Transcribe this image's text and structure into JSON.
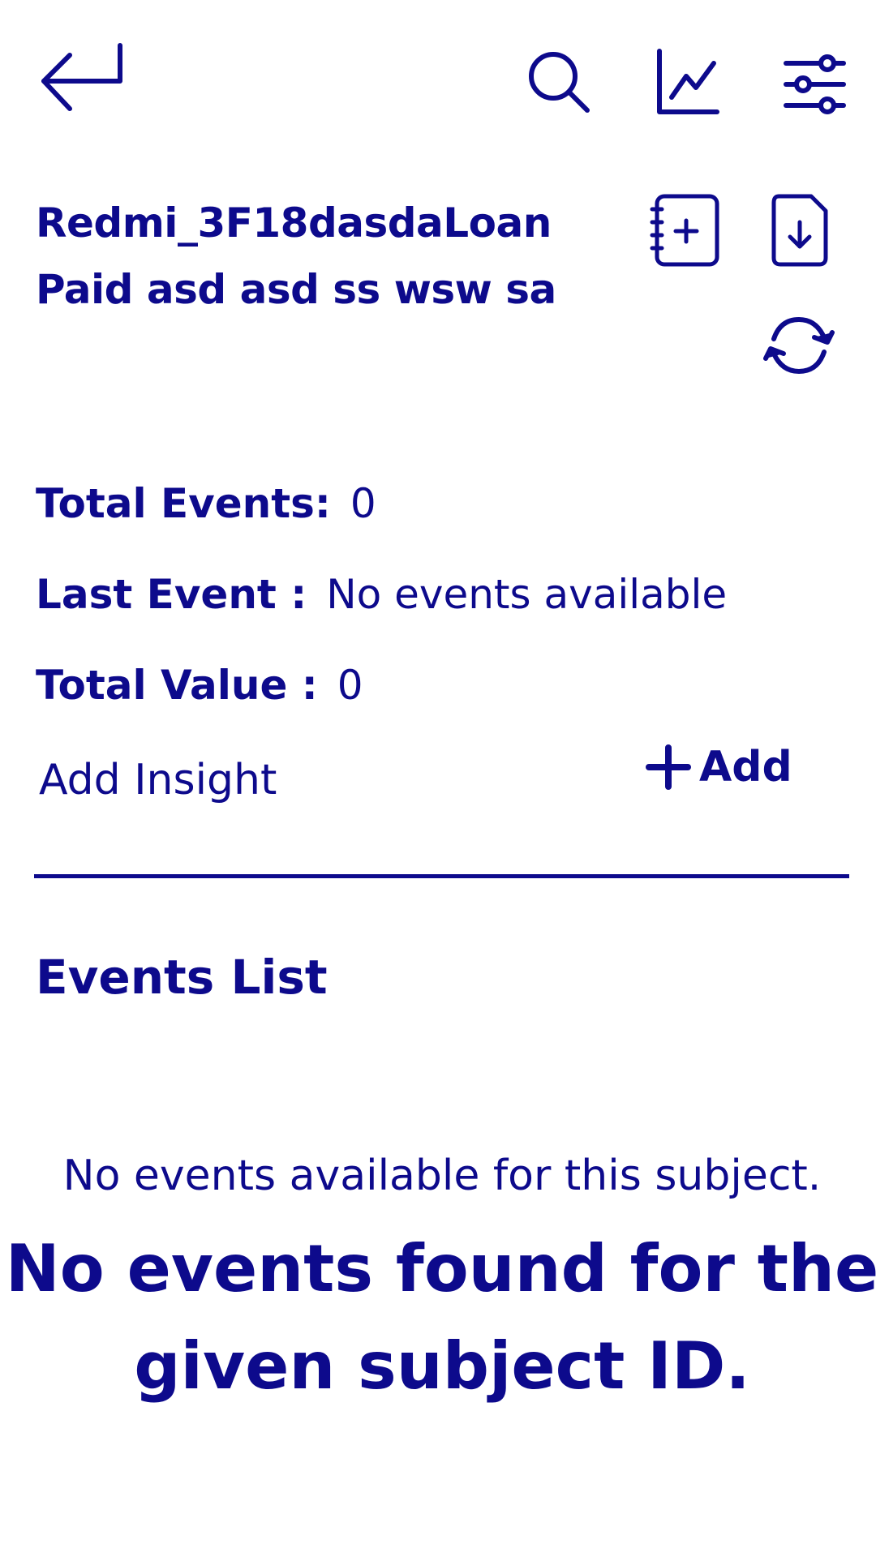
{
  "header": {
    "title": "Redmi_3F18dasdaLoan Paid asd asd ss wsw sa",
    "icons": [
      "back-icon",
      "search-icon",
      "chart-icon",
      "filter-sliders-icon",
      "add-note-icon",
      "download-file-icon",
      "refresh-icon"
    ]
  },
  "stats": {
    "total_events_label": "Total Events:",
    "total_events_value": "0",
    "last_event_label": "Last Event :",
    "last_event_value": "No events available",
    "total_value_label": "Total Value :",
    "total_value_value": "0"
  },
  "insight": {
    "label": "Add Insight",
    "add_button_label": "Add"
  },
  "events": {
    "section_title": "Events List",
    "empty_message": "No events available for this subject.",
    "empty_detail": "No events found for the given subject ID."
  },
  "colors": {
    "primary": "#0d0a8c",
    "background": "#ffffff"
  }
}
